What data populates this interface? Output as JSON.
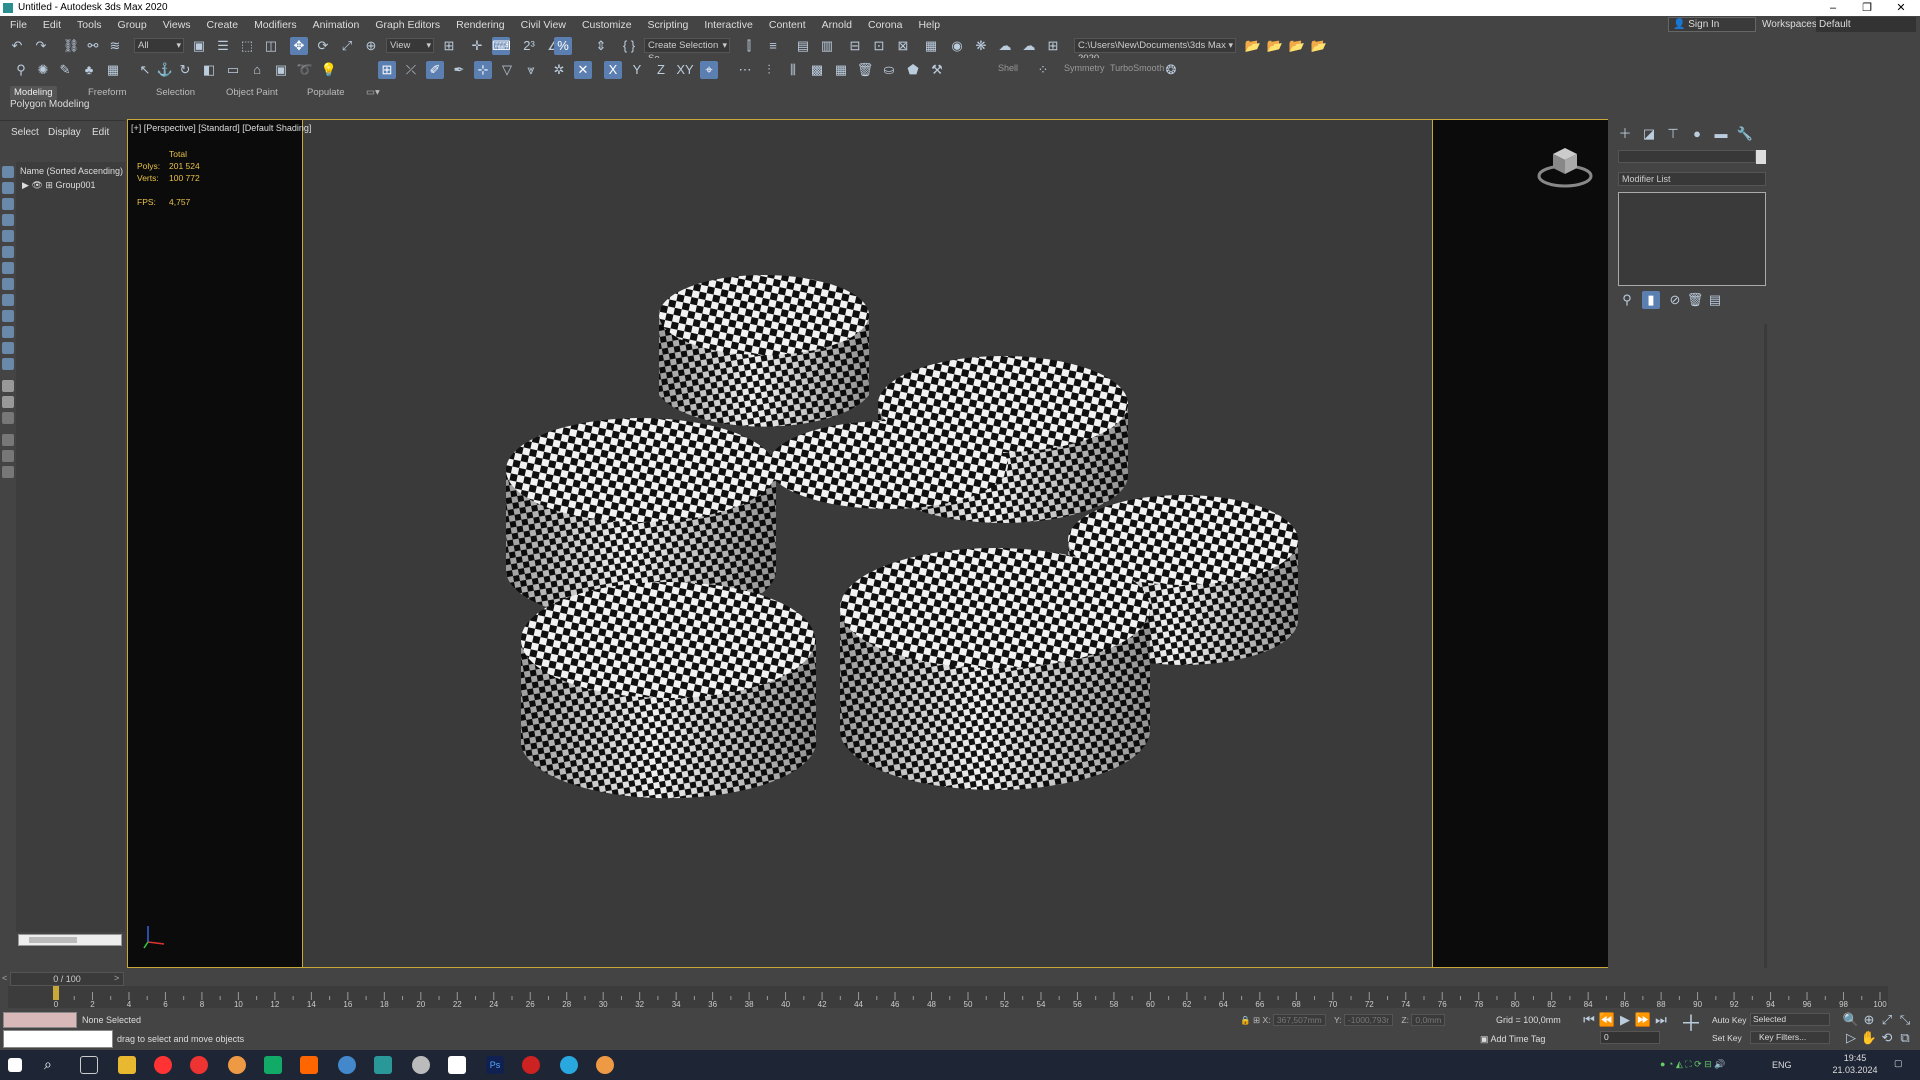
{
  "window": {
    "title": "Untitled - Autodesk 3ds Max 2020"
  },
  "menu": [
    "File",
    "Edit",
    "Tools",
    "Group",
    "Views",
    "Create",
    "Modifiers",
    "Animation",
    "Graph Editors",
    "Rendering",
    "Civil View",
    "Customize",
    "Scripting",
    "Interactive",
    "Content",
    "Arnold",
    "Corona",
    "Help"
  ],
  "account": {
    "sign_in": "Sign In",
    "workspaces_label": "Workspaces:",
    "workspace_value": "Default"
  },
  "toolbar": {
    "filter": "All",
    "ref_coord": "View",
    "selection_set": "Create Selection Se",
    "project_path": "C:\\Users\\New\\Documents\\3ds Max 2020"
  },
  "toolbar2": {
    "shell": "Shell",
    "symmetry": "Symmetry",
    "turbosmooth": "TurboSmooth"
  },
  "ribbon": {
    "tabs": [
      "Modeling",
      "Freeform",
      "Selection",
      "Object Paint",
      "Populate"
    ],
    "sub": "Polygon Modeling"
  },
  "scene_explorer": {
    "tabs": [
      "Select",
      "Display",
      "Edit"
    ],
    "header": "Name (Sorted Ascending)",
    "item": "Group001"
  },
  "viewport": {
    "label": "[+] [Perspective] [Standard] [Default Shading]",
    "stats": {
      "total": "Total",
      "polys_label": "Polys:",
      "polys": "201 524",
      "verts_label": "Verts:",
      "verts": "100 772",
      "fps_label": "FPS:",
      "fps": "4,757"
    }
  },
  "command_panel": {
    "modifier_list": "Modifier List"
  },
  "timeline": {
    "slider": "0 / 100",
    "ticks": [
      "0",
      "2",
      "4",
      "6",
      "8",
      "10",
      "12",
      "14",
      "16",
      "18",
      "20",
      "22",
      "24",
      "26",
      "28",
      "30",
      "32",
      "34",
      "36",
      "38",
      "40",
      "42",
      "44",
      "46",
      "48",
      "50",
      "52",
      "54",
      "56",
      "58",
      "60",
      "62",
      "64",
      "66",
      "68",
      "70",
      "72",
      "74",
      "76",
      "78",
      "80",
      "82",
      "84",
      "86",
      "88",
      "90",
      "92",
      "94",
      "96",
      "98",
      "100"
    ]
  },
  "status": {
    "none_selected": "None Selected",
    "prompt": "drag to select and move objects",
    "x_label": "X:",
    "x": "367,507mm",
    "y_label": "Y:",
    "y": "-1000,793r",
    "z_label": "Z:",
    "z": "0,0mm",
    "grid": "Grid = 100,0mm",
    "add_time_tag": "Add Time Tag",
    "auto_key": "Auto Key",
    "selected": "Selected",
    "set_key": "Set Key",
    "key_filters": "Key Filters...",
    "frame": "0"
  },
  "tray": {
    "lang": "ENG",
    "time": "19:45",
    "date": "21.03.2024"
  }
}
